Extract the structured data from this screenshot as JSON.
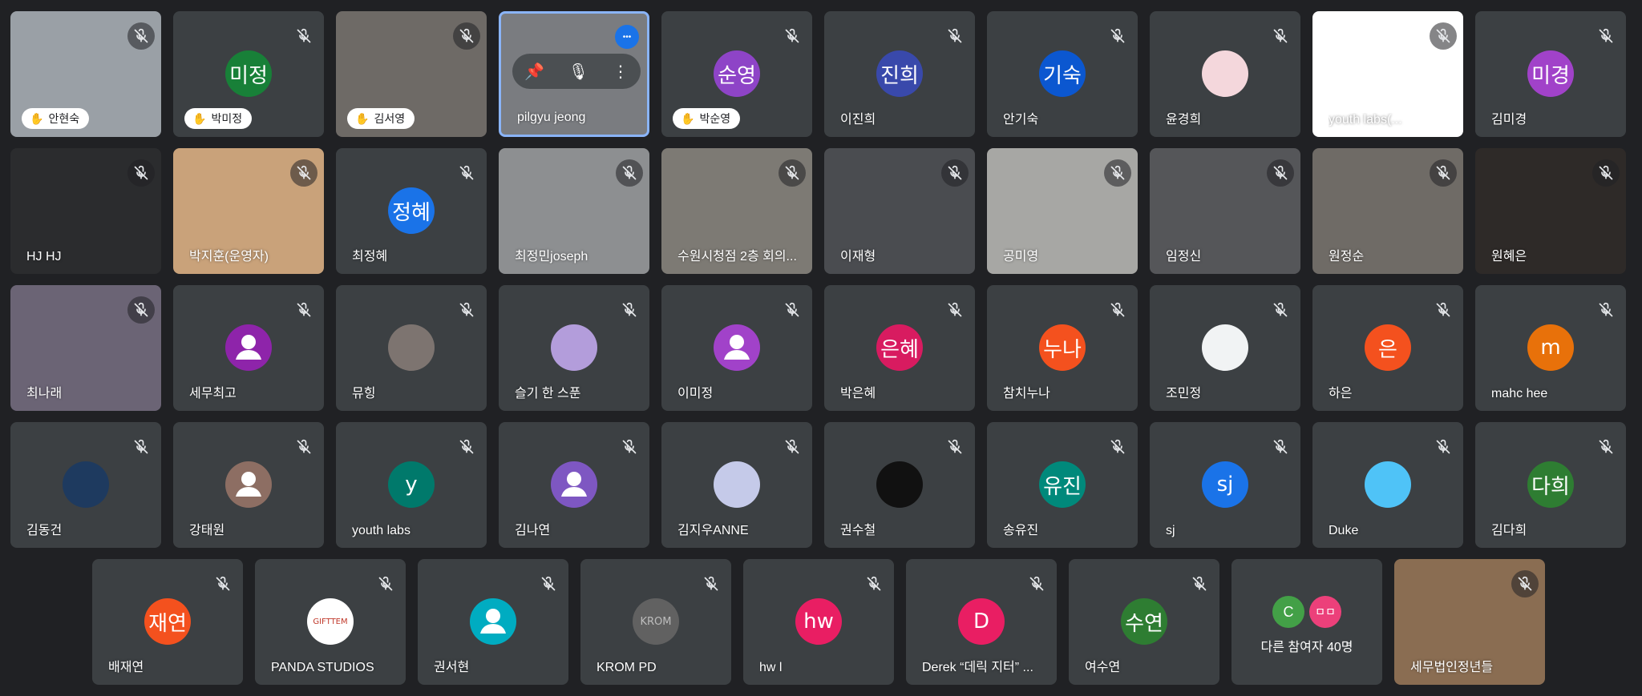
{
  "meeting": {
    "tiles": [
      {
        "row": 0,
        "col": 0,
        "name": "안현숙",
        "kind": "video",
        "bg": "#9aa0a6",
        "pill": true
      },
      {
        "row": 0,
        "col": 1,
        "name": "박미정",
        "kind": "avatar",
        "initials": "미정",
        "color": "#188038",
        "pill": true
      },
      {
        "row": 0,
        "col": 2,
        "name": "김서영",
        "kind": "video",
        "bg": "#6e6a66",
        "pill": true
      },
      {
        "row": 0,
        "col": 3,
        "name": "pilgyu jeong",
        "kind": "video",
        "bg": "#7a7c80",
        "active": true
      },
      {
        "row": 0,
        "col": 4,
        "name": "박순영",
        "kind": "avatar",
        "initials": "순영",
        "color": "#8e44c7",
        "pill": true
      },
      {
        "row": 0,
        "col": 5,
        "name": "이진희",
        "kind": "avatar",
        "initials": "진희",
        "color": "#3949ab"
      },
      {
        "row": 0,
        "col": 6,
        "name": "안기숙",
        "kind": "avatar",
        "initials": "기숙",
        "color": "#0b57d0"
      },
      {
        "row": 0,
        "col": 7,
        "name": "윤경희",
        "kind": "avatar",
        "initials": "",
        "color": "#f4d7dc"
      },
      {
        "row": 0,
        "col": 8,
        "name": "youth labs(...",
        "kind": "screen",
        "bg": "#ffffff"
      },
      {
        "row": 0,
        "col": 9,
        "name": "김미경",
        "kind": "avatar",
        "initials": "미경",
        "color": "#a142c9"
      },
      {
        "row": 1,
        "col": 0,
        "name": "HJ HJ",
        "kind": "video",
        "bg": "#2b2c2e"
      },
      {
        "row": 1,
        "col": 1,
        "name": "박지훈(운영자)",
        "kind": "video",
        "bg": "#c9a27a"
      },
      {
        "row": 1,
        "col": 2,
        "name": "최정혜",
        "kind": "avatar",
        "initials": "정혜",
        "color": "#1a73e8"
      },
      {
        "row": 1,
        "col": 3,
        "name": "최정민joseph",
        "kind": "video",
        "bg": "#8d8f91"
      },
      {
        "row": 1,
        "col": 4,
        "name": "수원시청점 2층 회의...",
        "kind": "video",
        "bg": "#7d7a74"
      },
      {
        "row": 1,
        "col": 5,
        "name": "이재형",
        "kind": "video",
        "bg": "#4a4c50"
      },
      {
        "row": 1,
        "col": 6,
        "name": "공미영",
        "kind": "video",
        "bg": "#a7a7a4"
      },
      {
        "row": 1,
        "col": 7,
        "name": "임정신",
        "kind": "video",
        "bg": "#555659"
      },
      {
        "row": 1,
        "col": 8,
        "name": "원정순",
        "kind": "video",
        "bg": "#6f6b66"
      },
      {
        "row": 1,
        "col": 9,
        "name": "원혜은",
        "kind": "video",
        "bg": "#2e2a28"
      },
      {
        "row": 2,
        "col": 0,
        "name": "최나래",
        "kind": "video",
        "bg": "#6b6475"
      },
      {
        "row": 2,
        "col": 1,
        "name": "세무최고",
        "kind": "avatar",
        "generic": true,
        "color": "#8e24aa"
      },
      {
        "row": 2,
        "col": 2,
        "name": "뮤힝",
        "kind": "avatar",
        "initials": "",
        "color": "#7d7470"
      },
      {
        "row": 2,
        "col": 3,
        "name": "슬기 한 스푼",
        "kind": "avatar",
        "initials": "",
        "color": "#b39ddb"
      },
      {
        "row": 2,
        "col": 4,
        "name": "이미정",
        "kind": "avatar",
        "generic": true,
        "color": "#a142c9"
      },
      {
        "row": 2,
        "col": 5,
        "name": "박은혜",
        "kind": "avatar",
        "initials": "은혜",
        "color": "#d81b60"
      },
      {
        "row": 2,
        "col": 6,
        "name": "참치누나",
        "kind": "avatar",
        "initials": "누나",
        "color": "#f4511e"
      },
      {
        "row": 2,
        "col": 7,
        "name": "조민정",
        "kind": "avatar",
        "initials": "",
        "color": "#f1f3f4"
      },
      {
        "row": 2,
        "col": 8,
        "name": "하은",
        "kind": "avatar",
        "initials": "은",
        "color": "#f4511e"
      },
      {
        "row": 2,
        "col": 9,
        "name": "mahc hee",
        "kind": "avatar",
        "initials": "m",
        "color": "#e8710a"
      },
      {
        "row": 3,
        "col": 0,
        "name": "김동건",
        "kind": "avatar",
        "initials": "",
        "color": "#1e3a5f"
      },
      {
        "row": 3,
        "col": 1,
        "name": "강태원",
        "kind": "avatar",
        "generic": true,
        "color": "#8d6e63"
      },
      {
        "row": 3,
        "col": 2,
        "name": "youth labs",
        "kind": "avatar",
        "initials": "y",
        "color": "#00796b"
      },
      {
        "row": 3,
        "col": 3,
        "name": "김나연",
        "kind": "avatar",
        "generic": true,
        "color": "#7e57c2"
      },
      {
        "row": 3,
        "col": 4,
        "name": "김지우ANNE",
        "kind": "avatar",
        "initials": "",
        "color": "#c5cae9"
      },
      {
        "row": 3,
        "col": 5,
        "name": "권수철",
        "kind": "avatar",
        "initials": "",
        "color": "#111111"
      },
      {
        "row": 3,
        "col": 6,
        "name": "송유진",
        "kind": "avatar",
        "initials": "유진",
        "color": "#00897b"
      },
      {
        "row": 3,
        "col": 7,
        "name": "sj",
        "kind": "avatar",
        "initials": "sj",
        "color": "#1a73e8"
      },
      {
        "row": 3,
        "col": 8,
        "name": "Duke",
        "kind": "avatar",
        "initials": "",
        "color": "#4fc3f7"
      },
      {
        "row": 3,
        "col": 9,
        "name": "김다희",
        "kind": "avatar",
        "initials": "다희",
        "color": "#2e7d32"
      },
      {
        "row": 4,
        "col": 0,
        "name": "배재연",
        "kind": "avatar",
        "initials": "재연",
        "color": "#f4511e"
      },
      {
        "row": 4,
        "col": 1,
        "name": "PANDA STUDIOS",
        "kind": "avatar",
        "initials": "GIFTTEM",
        "color": "#ffffff"
      },
      {
        "row": 4,
        "col": 2,
        "name": "권서현",
        "kind": "avatar",
        "generic": true,
        "color": "#00acc1"
      },
      {
        "row": 4,
        "col": 3,
        "name": "KROM PD",
        "kind": "avatar",
        "initials": "KROM",
        "color": "#616161"
      },
      {
        "row": 4,
        "col": 4,
        "name": "hw l",
        "kind": "avatar",
        "initials": "hw",
        "color": "#e91e63"
      },
      {
        "row": 4,
        "col": 5,
        "name": "Derek “데릭 지터” ...",
        "kind": "avatar",
        "initials": "D",
        "color": "#e91e63"
      },
      {
        "row": 4,
        "col": 6,
        "name": "여수연",
        "kind": "avatar",
        "initials": "수연",
        "color": "#2e7d32"
      },
      {
        "row": 4,
        "col": 7,
        "name": "다른 참여자 40명",
        "kind": "more",
        "a": "C",
        "b": "ㅁㅁ",
        "ca": "#43a047",
        "cb": "#ec407a"
      },
      {
        "row": 4,
        "col": 8,
        "name": "세무법인정년들",
        "kind": "video",
        "bg": "#8a6d52"
      }
    ]
  }
}
